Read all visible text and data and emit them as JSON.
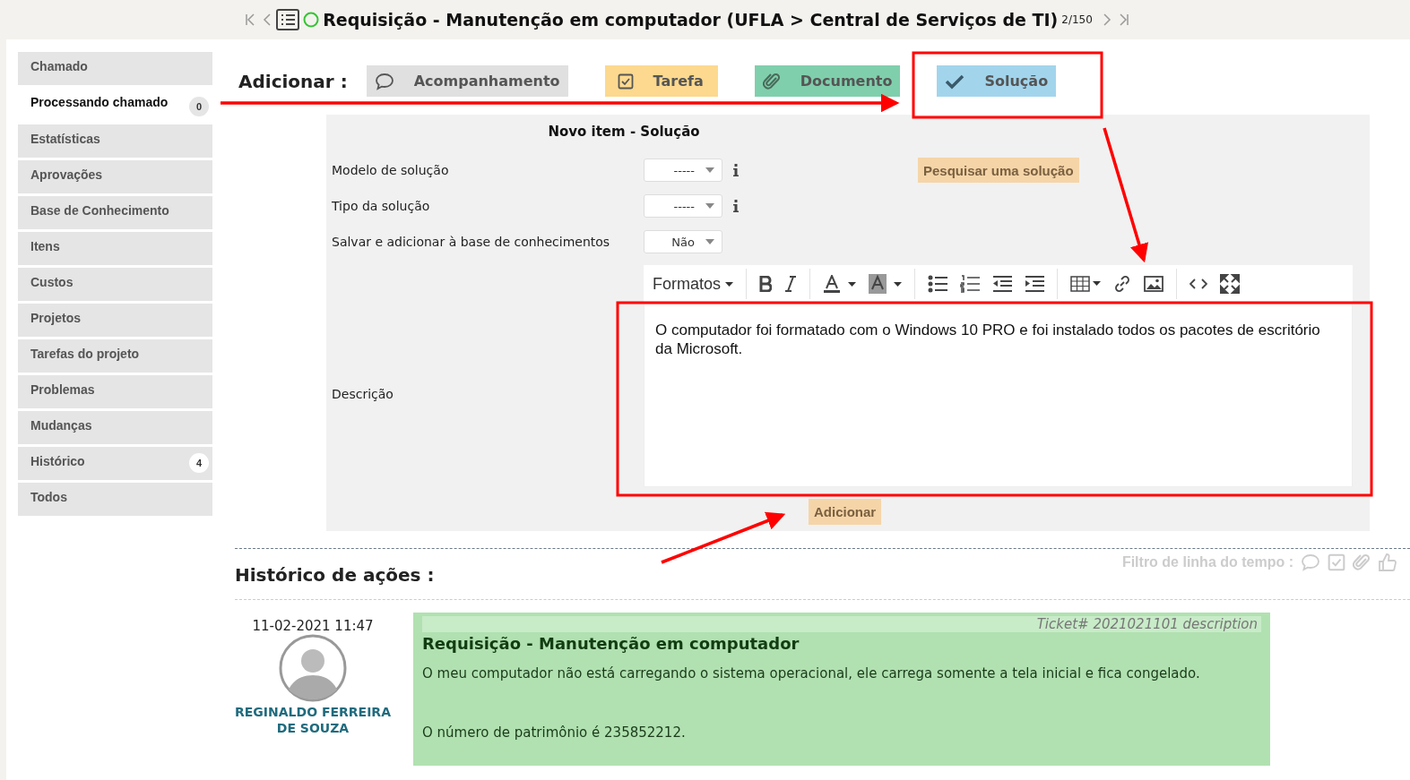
{
  "header": {
    "title": "Requisição - Manutenção em computador (UFLA > Central de Serviços de TI)",
    "counter": "2/150"
  },
  "sidebar": {
    "items": [
      {
        "label": "Chamado",
        "selected": false
      },
      {
        "label": "Processando chamado",
        "selected": true,
        "badge": "0"
      },
      {
        "label": "Estatísticas",
        "selected": false
      },
      {
        "label": "Aprovações",
        "selected": false
      },
      {
        "label": "Base de Conhecimento",
        "selected": false
      },
      {
        "label": "Itens",
        "selected": false
      },
      {
        "label": "Custos",
        "selected": false
      },
      {
        "label": "Projetos",
        "selected": false
      },
      {
        "label": "Tarefas do projeto",
        "selected": false
      },
      {
        "label": "Problemas",
        "selected": false
      },
      {
        "label": "Mudanças",
        "selected": false
      },
      {
        "label": "Histórico",
        "selected": false,
        "badge": "4"
      },
      {
        "label": "Todos",
        "selected": false
      }
    ]
  },
  "add_bar": {
    "label": "Adicionar :",
    "buttons": [
      {
        "label": "Acompanhamento",
        "kind": "followup",
        "color": "#e0e0e0"
      },
      {
        "label": "Tarefa",
        "kind": "task",
        "color": "#fcd98e"
      },
      {
        "label": "Documento",
        "kind": "document",
        "color": "#80cfac"
      },
      {
        "label": "Solução",
        "kind": "solution",
        "color": "#a2d5ec"
      }
    ]
  },
  "form": {
    "title": "Novo item - Solução",
    "fields": [
      {
        "label": "Modelo de solução",
        "value": "-----",
        "info": true
      },
      {
        "label": "Tipo da solução",
        "value": "-----",
        "info": true
      },
      {
        "label": "Salvar e adicionar à base de conhecimentos",
        "value": "Não",
        "info": false
      }
    ],
    "search_button": "Pesquisar uma solução",
    "description_label": "Descrição",
    "editor": {
      "formats": "Formatos",
      "text": "O computador foi formatado com o Windows 10 PRO e foi instalado todos os pacotes de escritório da Microsoft."
    },
    "submit": "Adicionar"
  },
  "history": {
    "title": "Histórico de ações :",
    "filter_label": "Filtro de linha do tempo :",
    "entries": [
      {
        "date": "11-02-2021 11:47",
        "author": "REGINALDO FERREIRA DE SOUZA",
        "ref": "Ticket# 2021021101 description",
        "title": "Requisição - Manutenção em computador",
        "paragraphs": [
          "O meu computador não está carregando o sistema operacional, ele carrega somente a tela inicial e fica congelado.",
          "O número de patrimônio é 235852212."
        ]
      }
    ]
  }
}
